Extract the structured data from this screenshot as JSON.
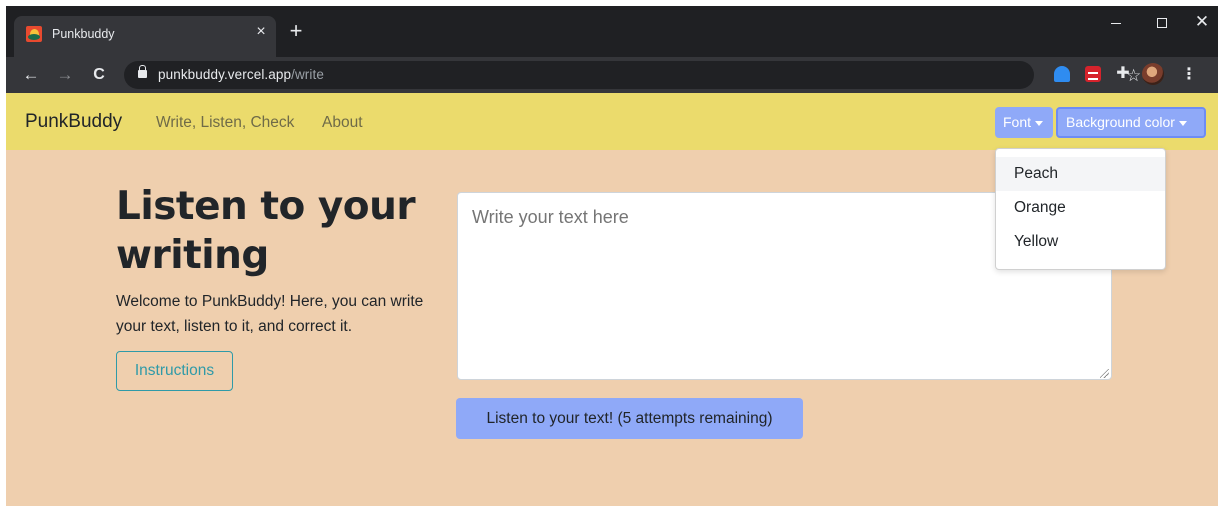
{
  "browser": {
    "tab_title": "Punkbuddy",
    "tab_close": "×",
    "new_tab": "+",
    "window_close": "✕",
    "url_host": "punkbuddy.vercel.app",
    "url_path": "/write",
    "icons": [
      "punkbuddy-favicon",
      "back-arrow-icon",
      "forward-arrow-icon",
      "reload-icon",
      "lock-icon",
      "star-icon",
      "extension-icon",
      "puzzle-icon",
      "profile-avatar",
      "kebab-menu-icon"
    ]
  },
  "navbar": {
    "brand": "PunkBuddy",
    "links": [
      "Write, Listen, Check",
      "About"
    ],
    "font_dropdown": "Font",
    "bg_dropdown": "Background color",
    "color": "#ebdb6c"
  },
  "dropdown_menu": {
    "items": [
      "Peach",
      "Orange",
      "Yellow"
    ],
    "highlighted": "Peach"
  },
  "main": {
    "heading_line1": "Listen to your",
    "heading_line2": "writing",
    "lead": "Welcome to PunkBuddy! Here, you can write your text, listen to it, and correct it.",
    "instructions_button": "Instructions",
    "textarea_placeholder": "Write your text here",
    "listen_button": "Listen to your text! (5 attempts remaining)"
  },
  "colors": {
    "page_background": "#efcfae",
    "button_blue": "#8fa9f8",
    "outline_teal": "#2f9aa8"
  }
}
